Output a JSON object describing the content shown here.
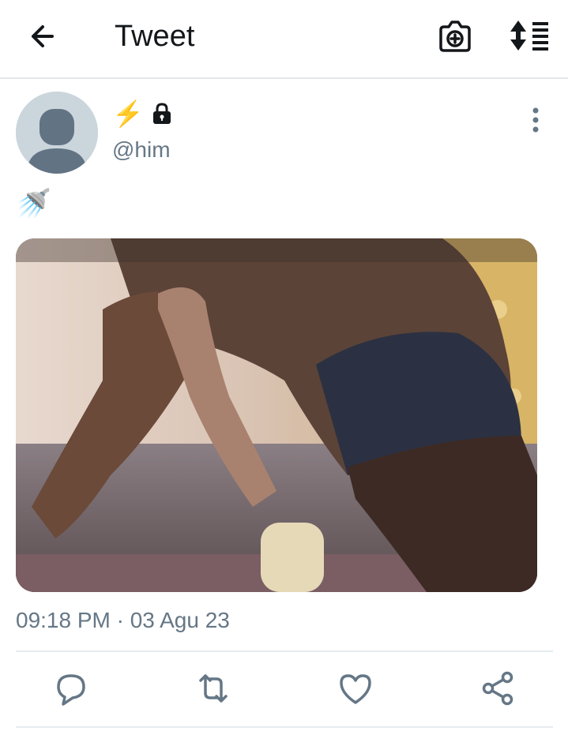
{
  "header": {
    "title": "Tweet",
    "back_icon": "arrow-left-icon",
    "camera_icon": "camera-add-icon",
    "sort_icon": "sort-list-icon"
  },
  "tweet": {
    "display_name_emoji": "⚡",
    "lock_icon": "lock-icon",
    "handle": "@him",
    "text": "🚿",
    "media": {
      "description": "photo"
    },
    "timestamp": "09:18 PM · 03 Agu 23"
  },
  "actions": {
    "reply_icon": "reply-icon",
    "retweet_icon": "retweet-icon",
    "like_icon": "like-heart-icon",
    "share_icon": "share-icon"
  },
  "colors": {
    "icon": "#657786",
    "text_primary": "#14171a",
    "text_secondary": "#657786",
    "divider": "#e6ecf0"
  }
}
